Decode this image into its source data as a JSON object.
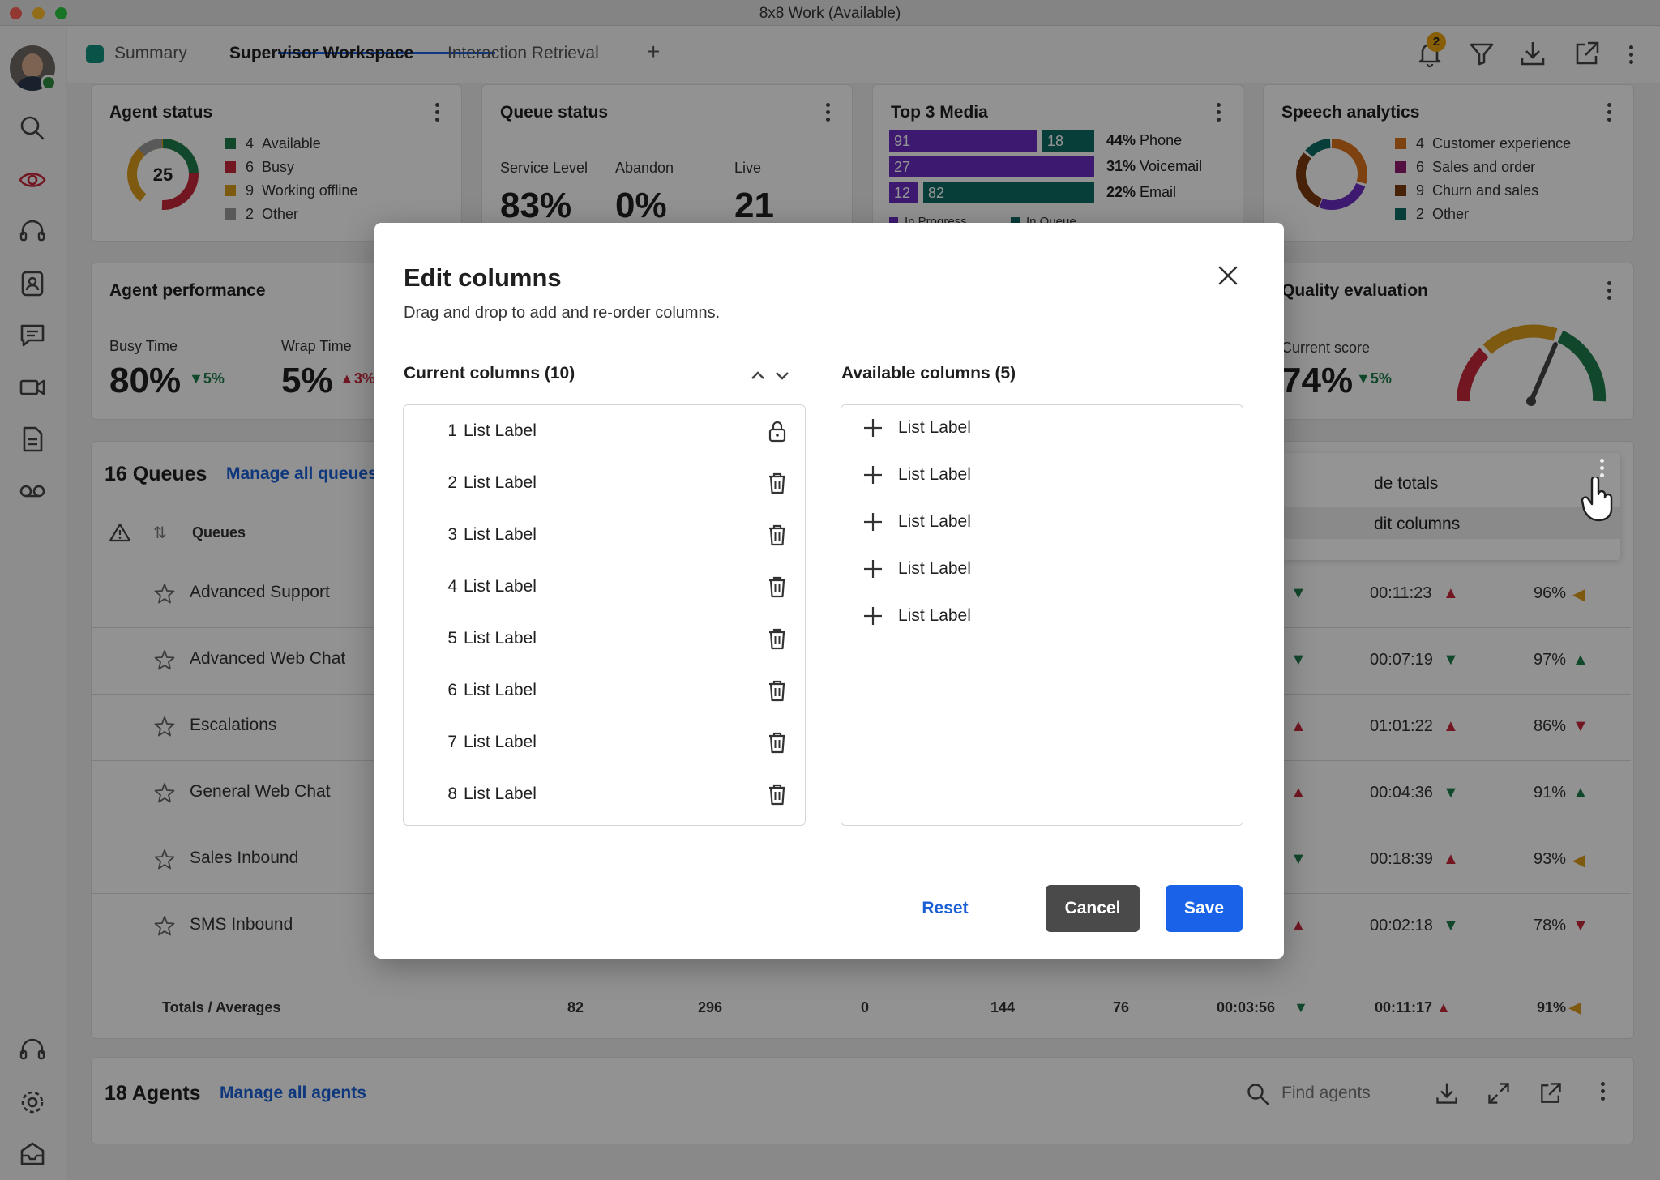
{
  "window": {
    "title": "8x8 Work (Available)"
  },
  "tabs": {
    "summary": "Summary",
    "supervisor": "Supervisor Workspace",
    "retrieval": "Interaction Retrieval",
    "add": "+"
  },
  "notifications": {
    "count": "2"
  },
  "agent_status": {
    "title": "Agent status",
    "total": "25",
    "items": [
      {
        "count": "4",
        "label": "Available",
        "color": "#1e7a4a"
      },
      {
        "count": "6",
        "label": "Busy",
        "color": "#c4283b"
      },
      {
        "count": "9",
        "label": "Working offline",
        "color": "#d99a1c"
      },
      {
        "count": "2",
        "label": "Other",
        "color": "#9a9a9a"
      }
    ]
  },
  "queue_status": {
    "title": "Queue status",
    "service_label": "Service Level",
    "service_value": "83%",
    "abandon_label": "Abandon",
    "abandon_value": "0%",
    "live_label": "Live",
    "live_value": "21"
  },
  "top_media": {
    "title": "Top 3 Media",
    "rows": [
      {
        "a": "91",
        "b": "18",
        "pct": "44%",
        "label": "Phone"
      },
      {
        "a": "27",
        "b": "",
        "pct": "31%",
        "label": "Voicemail"
      },
      {
        "a": "12",
        "b": "82",
        "pct": "22%",
        "label": "Email"
      }
    ],
    "legend_progress": "In Progress",
    "legend_queue": "In Queue"
  },
  "speech": {
    "title": "Speech analytics",
    "items": [
      {
        "count": "4",
        "label": "Customer experience",
        "color": "#d9711c"
      },
      {
        "count": "6",
        "label": "Sales and order",
        "color": "#8e1a6e"
      },
      {
        "count": "9",
        "label": "Churn and sales",
        "color": "#7a3a0e"
      },
      {
        "count": "2",
        "label": "Other",
        "color": "#0f6b63"
      }
    ]
  },
  "agent_perf": {
    "title": "Agent performance",
    "busy_label": "Busy Time",
    "busy_value": "80%",
    "busy_delta": "▼5%",
    "wrap_label": "Wrap Time",
    "wrap_value": "5%",
    "wrap_delta": "▲3%"
  },
  "quality": {
    "title": "Quality evaluation",
    "score_label": "Current score",
    "score_value": "74%",
    "score_delta": "▼5%"
  },
  "queues": {
    "title": "16 Queues",
    "manage": "Manage all queues",
    "col_queues": "Queues",
    "menu_totals": "de totals",
    "menu_edit": "dit columns",
    "rows": [
      {
        "name": "Advanced Support",
        "t1": "00:11:23",
        "p": "96%"
      },
      {
        "name": "Advanced Web Chat",
        "t1": "00:07:19",
        "p": "97%"
      },
      {
        "name": "Escalations",
        "t1": "01:01:22",
        "p": "86%"
      },
      {
        "name": "General Web Chat",
        "t1": "00:04:36",
        "p": "91%"
      },
      {
        "name": "Sales Inbound",
        "t1": "00:18:39",
        "p": "93%"
      },
      {
        "name": "SMS Inbound",
        "t1": "00:02:18",
        "p": "78%"
      }
    ],
    "totals_label": "Totals / Averages",
    "totals": [
      "82",
      "296",
      "0",
      "144",
      "76",
      "00:03:56",
      "00:11:17",
      "91%"
    ]
  },
  "agents": {
    "title": "18 Agents",
    "manage": "Manage all agents",
    "search_placeholder": "Find agents"
  },
  "modal": {
    "title": "Edit columns",
    "subtitle": "Drag and drop to add and re-order columns.",
    "current_header": "Current columns (10)",
    "available_header": "Available columns (5)",
    "current": [
      {
        "num": "1",
        "label": "List Label"
      },
      {
        "num": "2",
        "label": "List Label"
      },
      {
        "num": "3",
        "label": "List Label"
      },
      {
        "num": "4",
        "label": "List Label"
      },
      {
        "num": "5",
        "label": "List Label"
      },
      {
        "num": "6",
        "label": "List Label"
      },
      {
        "num": "7",
        "label": "List Label"
      },
      {
        "num": "8",
        "label": "List Label"
      }
    ],
    "available": [
      {
        "label": "List Label"
      },
      {
        "label": "List Label"
      },
      {
        "label": "List Label"
      },
      {
        "label": "List Label"
      },
      {
        "label": "List Label"
      }
    ],
    "reset": "Reset",
    "cancel": "Cancel",
    "save": "Save"
  },
  "colors": {
    "accent": "#1a63e8",
    "up": "#c4283b",
    "down": "#1e7a4a"
  }
}
